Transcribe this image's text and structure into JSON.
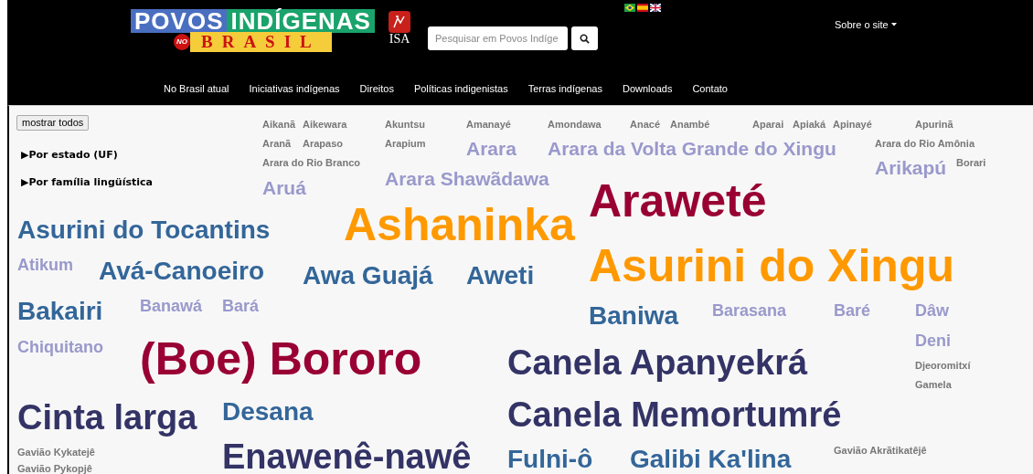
{
  "header": {
    "logo": {
      "word_1": "POVOS",
      "word_2": "INDÍGENAS",
      "badge": "NO",
      "word_3": "BRASIL"
    },
    "partner_logo": {
      "text": "ISA"
    },
    "search": {
      "placeholder": "Pesquisar em Povos Indíge"
    },
    "menu": {
      "label": "Sobre o site"
    },
    "nav": [
      "No Brasil atual",
      "Iniciativas indígenas",
      "Direitos",
      "Políticas indigenistas",
      "Terras indígenas",
      "Downloads",
      "Contato"
    ]
  },
  "sidebar": {
    "button": "mostrar todos",
    "filters": [
      {
        "label": "▶Por estado (UF)",
        "expanded": false
      },
      {
        "label": "▶Por família lingüística",
        "expanded": false
      }
    ]
  },
  "cloud": [
    {
      "name": "Aikanã",
      "kind": "xs",
      "color": "#777777"
    },
    {
      "name": "Aikewara",
      "kind": "xs",
      "color": "#777777"
    },
    {
      "name": "Akuntsu",
      "kind": "xs",
      "color": "#777777"
    },
    {
      "name": "Amanayé",
      "kind": "xs",
      "color": "#777777"
    },
    {
      "name": "Amondawa",
      "kind": "xs",
      "color": "#777777"
    },
    {
      "name": "Anacé",
      "kind": "xs",
      "color": "#777777"
    },
    {
      "name": "Anambé",
      "kind": "xs",
      "color": "#777777"
    },
    {
      "name": "Aparai",
      "kind": "xs",
      "color": "#777777"
    },
    {
      "name": "Apiaká",
      "kind": "xs",
      "color": "#777777"
    },
    {
      "name": "Apinayé",
      "kind": "xs",
      "color": "#777777"
    },
    {
      "name": "Apurinã",
      "kind": "xs",
      "color": "#777777"
    },
    {
      "name": "Aranã",
      "kind": "xs",
      "color": "#777777"
    },
    {
      "name": "Arapaso",
      "kind": "xs",
      "color": "#777777"
    },
    {
      "name": "Arapium",
      "kind": "xs",
      "color": "#777777"
    },
    {
      "name": "Arara",
      "kind": "md",
      "color": "#9999cc"
    },
    {
      "name": "Arara da Volta Grande do Xingu",
      "kind": "md",
      "color": "#9999cc"
    },
    {
      "name": "Arara do Rio Amônia",
      "kind": "xs",
      "color": "#777777"
    },
    {
      "name": "Arara do Rio Branco",
      "kind": "xs",
      "color": "#777777"
    },
    {
      "name": "Arikapú",
      "kind": "md",
      "color": "#9999cc"
    },
    {
      "name": "Borari",
      "kind": "xs",
      "color": "#777777"
    },
    {
      "name": "Arara Shawãdawa",
      "kind": "md",
      "color": "#9999cc"
    },
    {
      "name": "Aruá",
      "kind": "md",
      "color": "#9999cc"
    },
    {
      "name": "Araweté",
      "kind": "xxl",
      "color": "#990033"
    },
    {
      "name": "Asurini do Tocantins",
      "kind": "lg",
      "color": "#336699"
    },
    {
      "name": "Ashaninka",
      "kind": "xxl",
      "color": "#ff9900"
    },
    {
      "name": "Atikum",
      "kind": "sm",
      "color": "#9999cc"
    },
    {
      "name": "Avá-Canoeiro",
      "kind": "lg",
      "color": "#336699"
    },
    {
      "name": "Awa Guajá",
      "kind": "lg",
      "color": "#336699"
    },
    {
      "name": "Aweti",
      "kind": "lg",
      "color": "#336699"
    },
    {
      "name": "Asurini do Xingu",
      "kind": "xxl",
      "color": "#ff9900"
    },
    {
      "name": "Bakairi",
      "kind": "lg",
      "color": "#336699"
    },
    {
      "name": "Banawá",
      "kind": "sm",
      "color": "#9999cc"
    },
    {
      "name": "Bará",
      "kind": "sm",
      "color": "#9999cc"
    },
    {
      "name": "Baniwa",
      "kind": "lg",
      "color": "#336699"
    },
    {
      "name": "Barasana",
      "kind": "sm",
      "color": "#9999cc"
    },
    {
      "name": "Baré",
      "kind": "sm",
      "color": "#9999cc"
    },
    {
      "name": "Dâw",
      "kind": "sm",
      "color": "#9999cc"
    },
    {
      "name": "Deni",
      "kind": "sm",
      "color": "#9999cc"
    },
    {
      "name": "Chiquitano",
      "kind": "sm",
      "color": "#9999cc"
    },
    {
      "name": "(Boe) Bororo",
      "kind": "xxl",
      "color": "#990033"
    },
    {
      "name": "Canela Apanyekrá",
      "kind": "xl",
      "color": "#333366"
    },
    {
      "name": "Djeoromitxí",
      "kind": "xs",
      "color": "#777777"
    },
    {
      "name": "Gamela",
      "kind": "xs",
      "color": "#777777"
    },
    {
      "name": "Cinta larga",
      "kind": "xl",
      "color": "#333366"
    },
    {
      "name": "Desana",
      "kind": "lg",
      "color": "#336699"
    },
    {
      "name": "Canela Memortumré",
      "kind": "xl",
      "color": "#333366"
    },
    {
      "name": "Gavião Kykatejê",
      "kind": "xs",
      "color": "#777777"
    },
    {
      "name": "Enawenê-nawê",
      "kind": "xl",
      "color": "#333366"
    },
    {
      "name": "Fulni-ô",
      "kind": "lg",
      "color": "#336699"
    },
    {
      "name": "Galibi Ka'lina",
      "kind": "lg",
      "color": "#336699"
    },
    {
      "name": "Gavião Akrãtikatêjê",
      "kind": "xs",
      "color": "#777777"
    },
    {
      "name": "Gavião Pykopjê",
      "kind": "xs",
      "color": "#777777"
    }
  ]
}
